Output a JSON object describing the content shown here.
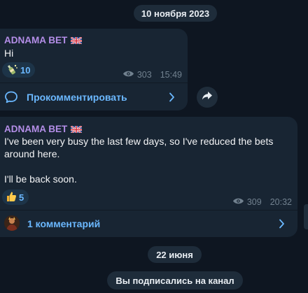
{
  "date_separators": {
    "first": "10 ноября 2023",
    "second": "22 июня"
  },
  "messages": [
    {
      "channel_name": "ADNAMA BET",
      "flag": "uk-flag-icon",
      "text": "Hi",
      "reaction": {
        "emoji": "bottle-icon",
        "count": "10"
      },
      "views": "303",
      "time": "15:49",
      "comment_label": "Прокомментировать",
      "comment_icon": "comment-bubble-icon"
    },
    {
      "channel_name": "ADNAMA BET",
      "flag": "uk-flag-icon",
      "text_line1": "I've been very busy the last few days, so I've reduced the bets around here.",
      "text_line2": "I'll be back soon.",
      "reaction": {
        "emoji": "thumbs-up-icon",
        "count": "5"
      },
      "views": "309",
      "time": "20:32",
      "comment_label": "1 комментарий",
      "comment_icon": "commenter-avatar"
    }
  ],
  "service_message": "Вы подписались на канал",
  "colors": {
    "background": "#0e1621",
    "bubble": "#182533",
    "channel_name": "#b48ee8",
    "accent": "#6bb8ff",
    "meta": "#71818f"
  }
}
